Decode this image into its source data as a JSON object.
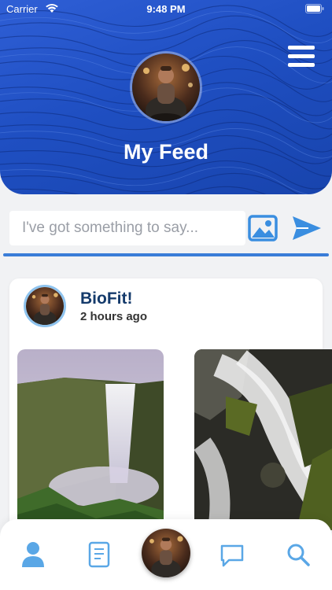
{
  "status_bar": {
    "carrier": "Carrier",
    "time": "9:48 PM",
    "wifi_icon": "wifi-icon",
    "battery_icon": "battery-icon"
  },
  "header": {
    "title": "My Feed",
    "menu_icon": "hamburger-menu-icon",
    "profile_avatar": "profile-avatar-photo",
    "background_color": "#2555c8"
  },
  "composer": {
    "placeholder": "I've got something to say...",
    "value": "",
    "image_icon": "image-icon",
    "send_icon": "send-icon",
    "accent_color": "#3a7dd8"
  },
  "feed": {
    "posts": [
      {
        "author": "BioFit!",
        "time": "2 hours ago",
        "images": [
          "waterfall-photo",
          "waterfall-rocks-photo"
        ]
      }
    ]
  },
  "bottom_nav": {
    "items": [
      {
        "icon": "user-icon"
      },
      {
        "icon": "notes-icon"
      },
      {
        "icon": "avatar-center"
      },
      {
        "icon": "message-icon"
      },
      {
        "icon": "search-icon"
      }
    ],
    "icon_color": "#5aa7e6"
  }
}
